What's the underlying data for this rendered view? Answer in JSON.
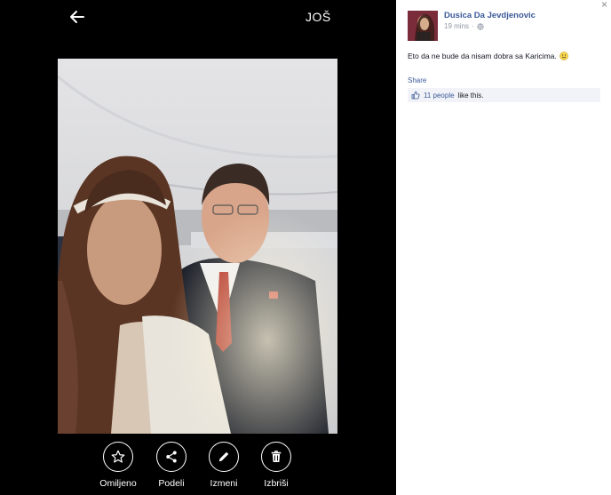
{
  "viewer": {
    "more_label": "JOŠ",
    "actions": [
      {
        "label": "Omiljeno",
        "icon": "star-icon"
      },
      {
        "label": "Podeli",
        "icon": "share-icon"
      },
      {
        "label": "Izmeni",
        "icon": "pencil-icon"
      },
      {
        "label": "Izbriši",
        "icon": "trash-icon"
      }
    ]
  },
  "post": {
    "author": "Dusica Da Jevdjenovic",
    "time": "19 mins",
    "separator": "·",
    "caption": "Eto da ne bude da nisam dobra sa Karicima.",
    "share_label": "Share",
    "likes_count": "11 people",
    "likes_suffix": "like this.",
    "close_symbol": "×"
  },
  "colors": {
    "link": "#3b5998",
    "likes_bg": "#f1f3f8",
    "viewer_bg": "#000000"
  }
}
